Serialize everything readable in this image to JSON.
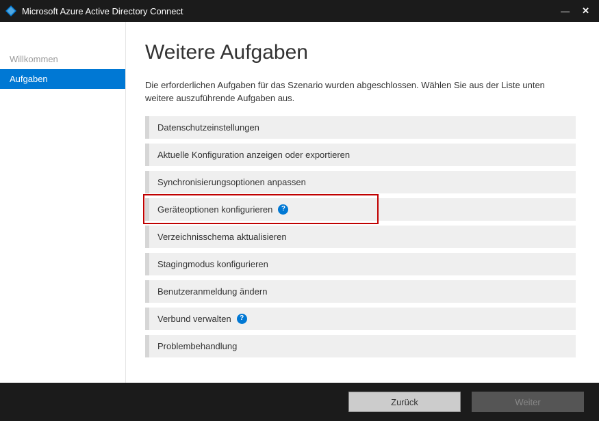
{
  "window": {
    "title": "Microsoft Azure Active Directory Connect"
  },
  "sidebar": {
    "items": [
      {
        "label": "Willkommen",
        "active": false
      },
      {
        "label": "Aufgaben",
        "active": true
      }
    ]
  },
  "main": {
    "heading": "Weitere Aufgaben",
    "description": "Die erforderlichen Aufgaben für das Szenario wurden abgeschlossen. Wählen Sie aus der Liste unten weitere auszuführende Aufgaben aus.",
    "tasks": [
      {
        "label": "Datenschutzeinstellungen",
        "help": false,
        "highlight": false
      },
      {
        "label": "Aktuelle Konfiguration anzeigen oder exportieren",
        "help": false,
        "highlight": false
      },
      {
        "label": "Synchronisierungsoptionen anpassen",
        "help": false,
        "highlight": false
      },
      {
        "label": "Geräteoptionen konfigurieren",
        "help": true,
        "highlight": true
      },
      {
        "label": "Verzeichnisschema aktualisieren",
        "help": false,
        "highlight": false
      },
      {
        "label": "Stagingmodus konfigurieren",
        "help": false,
        "highlight": false
      },
      {
        "label": "Benutzeranmeldung ändern",
        "help": false,
        "highlight": false
      },
      {
        "label": "Verbund verwalten",
        "help": true,
        "highlight": false
      },
      {
        "label": "Problembehandlung",
        "help": false,
        "highlight": false
      }
    ]
  },
  "footer": {
    "back_label": "Zurück",
    "next_label": "Weiter"
  }
}
